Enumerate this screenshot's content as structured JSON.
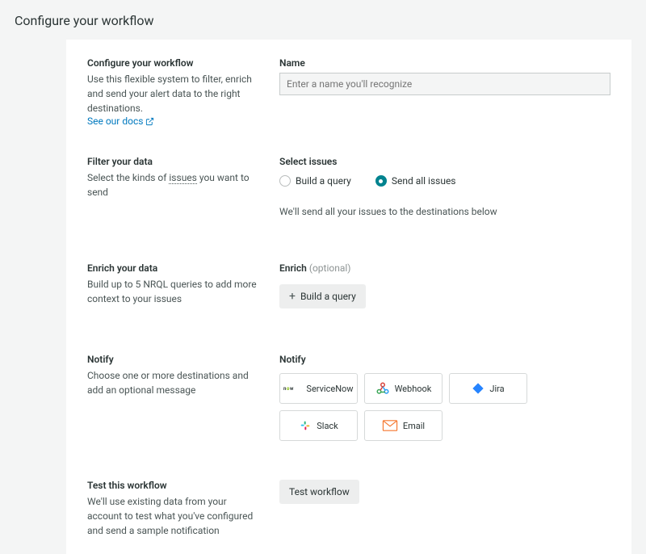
{
  "page": {
    "title": "Configure your workflow"
  },
  "sections": {
    "configure": {
      "heading": "Configure your workflow",
      "desc": "Use this flexible system to filter, enrich and send your alert data to the right destinations.",
      "docs_link": "See our docs"
    },
    "name": {
      "label": "Name",
      "placeholder": "Enter a name you'll recognize",
      "value": ""
    },
    "filter": {
      "heading": "Filter your data",
      "desc_pre": "Select the kinds of ",
      "desc_link": "issues",
      "desc_post": " you want to send",
      "select_label": "Select issues",
      "options": {
        "build": "Build a query",
        "send_all": "Send all issues"
      },
      "selected": "send_all",
      "hint": "We'll send all your issues to the destinations below"
    },
    "enrich": {
      "heading": "Enrich your data",
      "desc": "Build up to 5 NRQL queries to add more context to your issues",
      "label": "Enrich",
      "optional": "(optional)",
      "button": "Build a query"
    },
    "notify": {
      "heading": "Notify",
      "desc": "Choose one or more destinations and add an optional message",
      "label": "Notify",
      "destinations": [
        {
          "id": "servicenow",
          "label": "ServiceNow"
        },
        {
          "id": "webhook",
          "label": "Webhook"
        },
        {
          "id": "jira",
          "label": "Jira"
        },
        {
          "id": "slack",
          "label": "Slack"
        },
        {
          "id": "email",
          "label": "Email"
        }
      ]
    },
    "test": {
      "heading": "Test this workflow",
      "desc": "We'll use existing data from your account to test what you've configured and send a sample notification",
      "button": "Test workflow"
    }
  }
}
